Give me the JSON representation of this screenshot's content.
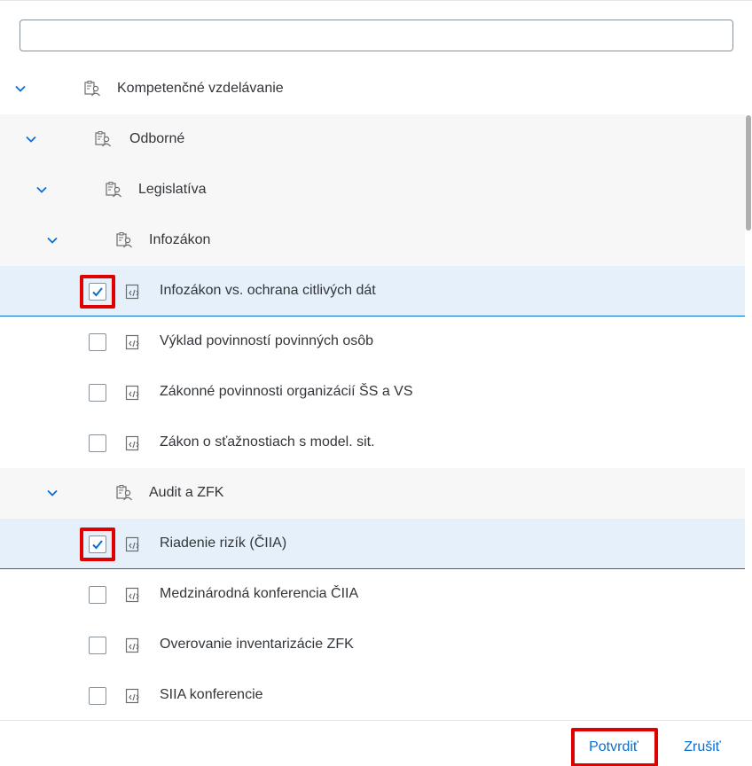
{
  "search": {
    "placeholder": "",
    "value": ""
  },
  "tree": {
    "nodes": [
      {
        "label": "Kompetenčné vzdelávanie",
        "type": "folder",
        "expanded": true,
        "level": 0
      },
      {
        "label": "Odborné",
        "type": "folder",
        "expanded": true,
        "level": 1
      },
      {
        "label": "Legislatíva",
        "type": "folder",
        "expanded": true,
        "level": 2
      },
      {
        "label": "Infozákon",
        "type": "folder",
        "expanded": true,
        "level": 3
      },
      {
        "label": "Infozákon vs. ochrana citlivých dát",
        "type": "leaf",
        "checked": true
      },
      {
        "label": "Výklad povinností povinných osôb",
        "type": "leaf",
        "checked": false
      },
      {
        "label": "Zákonné povinnosti organizácií ŠS a VS",
        "type": "leaf",
        "checked": false
      },
      {
        "label": "Zákon o sťažnostiach s model. sit.",
        "type": "leaf",
        "checked": false
      },
      {
        "label": "Audit a ZFK",
        "type": "folder",
        "expanded": true,
        "level": 3
      },
      {
        "label": "Riadenie rizík (ČIIA)",
        "type": "leaf",
        "checked": true
      },
      {
        "label": "Medzinárodná konferencia ČIIA",
        "type": "leaf",
        "checked": false
      },
      {
        "label": "Overovanie inventarizácie ZFK",
        "type": "leaf",
        "checked": false
      },
      {
        "label": "SIIA konferencie",
        "type": "leaf",
        "checked": false
      }
    ]
  },
  "footer": {
    "confirm_label": "Potvrdiť",
    "cancel_label": "Zrušiť"
  },
  "colors": {
    "accent": "#0a6ed1",
    "highlight": "#e00000",
    "selected_bg": "#e5f0fa",
    "row_grey": "#f7f7f7"
  },
  "icons": {
    "expand": "chevron-down-icon",
    "folder": "folder-person-icon",
    "leaf": "course-code-icon",
    "check": "checkmark-icon"
  }
}
